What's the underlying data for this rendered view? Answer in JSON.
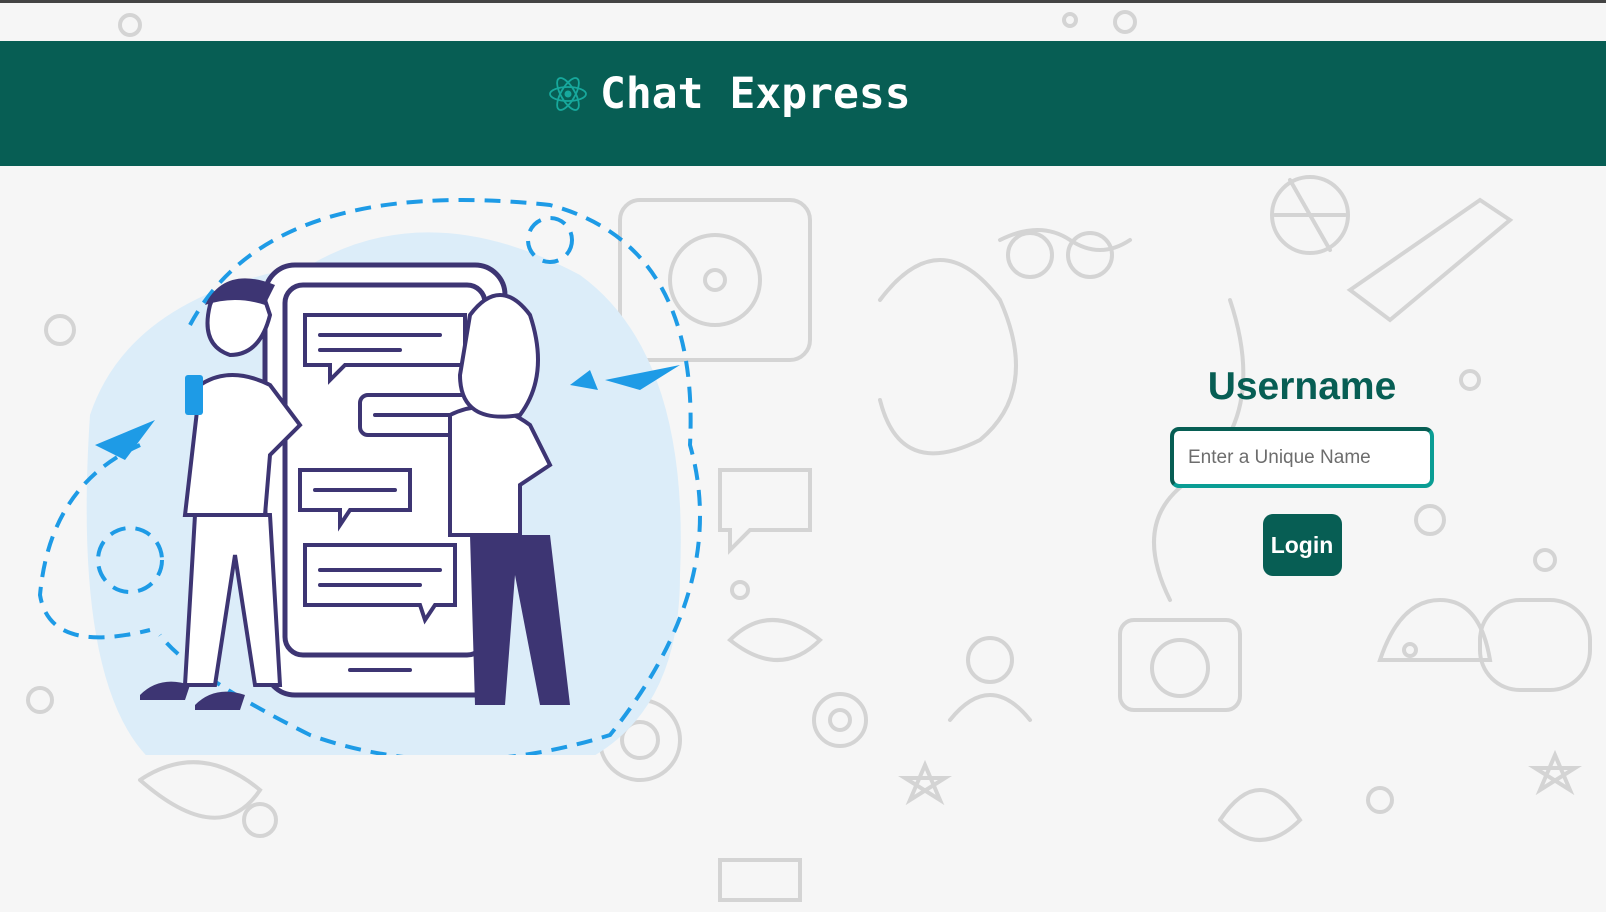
{
  "header": {
    "title": "Chat Express",
    "logo_icon": "react-atom-icon"
  },
  "login": {
    "label": "Username",
    "placeholder": "Enter a Unique Name",
    "value": "",
    "button_label": "Login"
  },
  "colors": {
    "brand": "#075e54",
    "accent": "#0a9d94",
    "illustration_blue": "#1e9be6",
    "illustration_ink": "#3d3573"
  }
}
